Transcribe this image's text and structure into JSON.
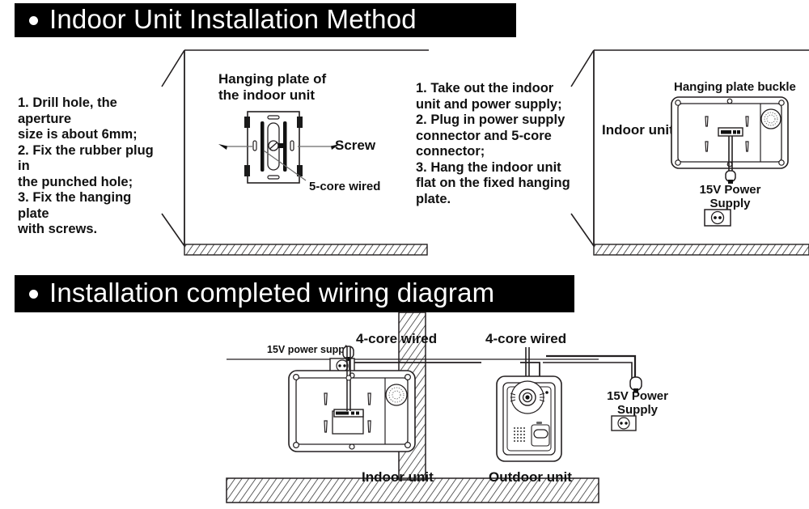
{
  "sections": [
    {
      "id": "indoor-unit-installation-method",
      "title": "Indoor Unit Installation Method",
      "bullet": "bullet-dot"
    },
    {
      "id": "installation-completed-wiring-diagram",
      "title": "Installation completed wiring diagram",
      "bullet": "bullet-dot"
    }
  ],
  "step_block_left": {
    "text": "1. Drill hole, the aperture\nsize is about 6mm;\n2. Fix the rubber plug in\nthe punched hole;\n3. Fix the hanging plate\nwith screws."
  },
  "panel_hanging_plate": {
    "caption": "Hanging plate of\nthe indoor unit",
    "label_screw": "Screw",
    "label_core_wired": "5-core wired"
  },
  "step_block_right": {
    "text": "1. Take out the indoor\nunit and power supply;\n2. Plug in power supply\nconnector and 5-core\nconnector;\n3. Hang the indoor unit\nflat on the fixed hanging\nplate."
  },
  "panel_indoor_unit": {
    "label_buckle": "Hanging plate buckle",
    "label_indoor_unit": "Indoor unit",
    "label_power": "15V Power\nSupply",
    "socket_icon": "wall-socket-icon"
  },
  "wiring_diagram": {
    "label_power_supply_left": "15V power supply",
    "label_core_left": "4-core wired",
    "label_core_right": "4-core wired",
    "label_indoor_unit": "Indoor unit",
    "label_outdoor_unit": "Outdoor unit",
    "label_power_right": "15V Power\nSupply",
    "socket_icon_left": "wall-socket-icon",
    "socket_icon_right": "wall-socket-icon"
  },
  "colors": {
    "title_bg": "#000000",
    "title_fg": "#ffffff",
    "line": "#231f20",
    "hatch": "#2b2b2b",
    "body_text": "#111111"
  }
}
